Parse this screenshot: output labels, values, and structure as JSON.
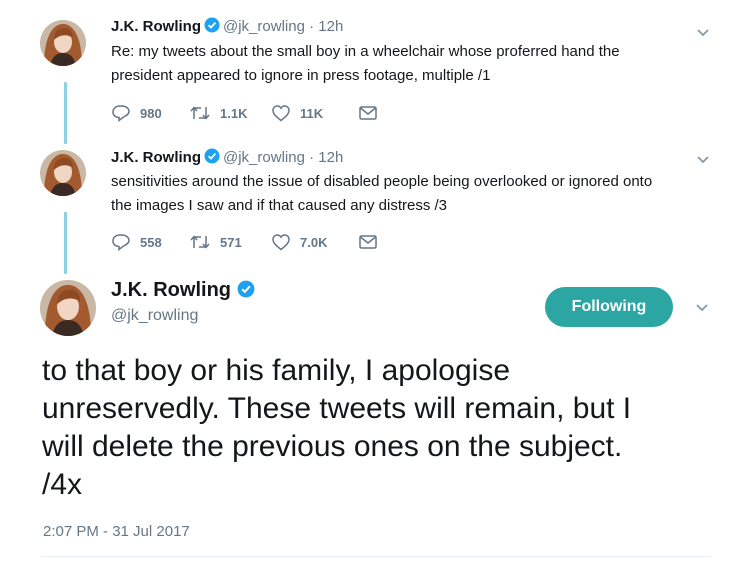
{
  "tweets": [
    {
      "name": "J.K. Rowling",
      "handle": "@jk_rowling",
      "separator": "·",
      "time": "12h",
      "text_line1": "Re: my tweets about the small boy in a wheelchair whose proferred hand the",
      "text_line2": "president appeared to ignore in press footage, multiple /1",
      "replies": "980",
      "retweets": "1.1K",
      "likes": "11K"
    },
    {
      "name": "J.K. Rowling",
      "handle": "@jk_rowling",
      "separator": "·",
      "time": "12h",
      "text_line1": "sensitivities around the issue of disabled people being overlooked or ignored onto",
      "text_line2": "the images I saw and if that caused any distress /3",
      "replies": "558",
      "retweets": "571",
      "likes": "7.0K"
    }
  ],
  "main": {
    "name": "J.K. Rowling",
    "handle": "@jk_rowling",
    "follow_label": "Following",
    "text_line1": "to that boy or his family, I apologise",
    "text_line2": "unreservedly. These tweets will remain, but I",
    "text_line3": "will delete the previous ones on the subject.",
    "text_line4": "/4x",
    "timestamp": "2:07 PM - 31 Jul 2017"
  },
  "colors": {
    "verified": "#1da1f2",
    "follow_button": "#2ba6a2",
    "thread_line": "#8ed0e8",
    "secondary_text": "#657786"
  },
  "icons": [
    "reply-icon",
    "retweet-icon",
    "like-icon",
    "dm-icon",
    "verified-icon",
    "chevron-down-icon"
  ]
}
